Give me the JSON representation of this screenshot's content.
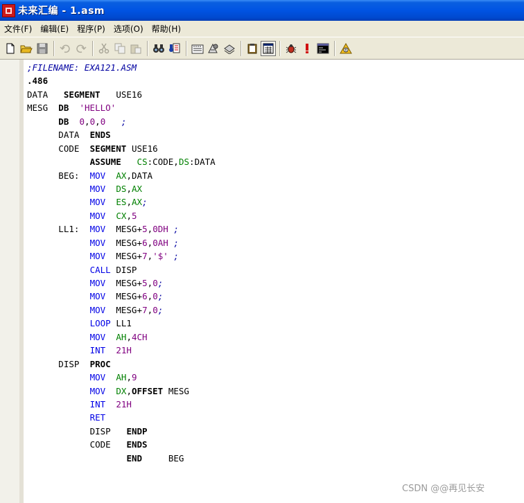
{
  "window": {
    "title": "未来汇编 - 1.asm"
  },
  "menu": [
    "文件(F)",
    "编辑(E)",
    "程序(P)",
    "选项(O)",
    "帮助(H)"
  ],
  "toolbar_groups": [
    [
      "new-file-icon",
      "open-folder-icon",
      "save-disk-icon"
    ],
    [
      "undo-icon",
      "redo-icon"
    ],
    [
      "cut-icon",
      "copy-icon",
      "paste-icon"
    ],
    [
      "find-binoculars-icon",
      "replace-icon"
    ],
    [
      "compile-icon",
      "link-icon",
      "build-icon"
    ],
    [
      "clipboard-icon",
      "register-window-icon"
    ],
    [
      "debug-bug-icon",
      "error-exclamation-icon",
      "console-icon"
    ],
    [
      "help-icon"
    ]
  ],
  "editor": {
    "lines": [
      [
        {
          "t": ";FILENAME: EXA121.ASM",
          "c": "com",
          "col": 0
        }
      ],
      [
        {
          "t": ".486",
          "c": "kw",
          "col": 0
        }
      ],
      [
        {
          "t": "DATA",
          "c": "default",
          "col": 0
        },
        {
          "t": "SEGMENT",
          "c": "kw",
          "col": 7
        },
        {
          "t": "USE16",
          "c": "default",
          "col": 17
        }
      ],
      [
        {
          "t": "MESG",
          "c": "default",
          "col": 0
        },
        {
          "t": "DB",
          "c": "kw",
          "col": 6
        },
        {
          "t": "'HELLO'",
          "c": "str",
          "col": 10
        }
      ],
      [
        {
          "t": "DB",
          "c": "kw",
          "col": 6
        },
        {
          "t": "0",
          "c": "num",
          "col": 10
        },
        {
          "t": ",",
          "c": "punc",
          "col": 11
        },
        {
          "t": "0",
          "c": "num",
          "col": 12
        },
        {
          "t": ",",
          "c": "punc",
          "col": 13
        },
        {
          "t": "0",
          "c": "num",
          "col": 14
        },
        {
          "t": ";",
          "c": "com",
          "col": 18
        }
      ],
      [
        {
          "t": "DATA",
          "c": "default",
          "col": 6
        },
        {
          "t": "ENDS",
          "c": "kw",
          "col": 12
        }
      ],
      [
        {
          "t": "CODE",
          "c": "default",
          "col": 6
        },
        {
          "t": "SEGMENT",
          "c": "kw",
          "col": 12
        },
        {
          "t": "USE16",
          "c": "default",
          "col": 20
        }
      ],
      [
        {
          "t": "ASSUME",
          "c": "kw",
          "col": 12
        },
        {
          "t": "CS",
          "c": "reg",
          "col": 21
        },
        {
          "t": ":CODE,",
          "c": "default",
          "col": 23
        },
        {
          "t": "DS",
          "c": "reg",
          "col": 29
        },
        {
          "t": ":DATA",
          "c": "default",
          "col": 31
        }
      ],
      [
        {
          "t": "BEG:",
          "c": "default",
          "col": 6
        },
        {
          "t": "MOV",
          "c": "ins",
          "col": 12
        },
        {
          "t": "AX",
          "c": "reg",
          "col": 17
        },
        {
          "t": ",DATA",
          "c": "default",
          "col": 19
        }
      ],
      [
        {
          "t": "MOV",
          "c": "ins",
          "col": 12
        },
        {
          "t": "DS",
          "c": "reg",
          "col": 17
        },
        {
          "t": ",",
          "c": "punc",
          "col": 19
        },
        {
          "t": "AX",
          "c": "reg",
          "col": 20
        }
      ],
      [
        {
          "t": "MOV",
          "c": "ins",
          "col": 12
        },
        {
          "t": "ES",
          "c": "reg",
          "col": 17
        },
        {
          "t": ",",
          "c": "punc",
          "col": 19
        },
        {
          "t": "AX",
          "c": "reg",
          "col": 20
        },
        {
          "t": ";",
          "c": "com",
          "col": 22
        }
      ],
      [
        {
          "t": "MOV",
          "c": "ins",
          "col": 12
        },
        {
          "t": "CX",
          "c": "reg",
          "col": 17
        },
        {
          "t": ",",
          "c": "punc",
          "col": 19
        },
        {
          "t": "5",
          "c": "num",
          "col": 20
        }
      ],
      [
        {
          "t": "LL1:",
          "c": "default",
          "col": 6
        },
        {
          "t": "MOV",
          "c": "ins",
          "col": 12
        },
        {
          "t": "MESG+",
          "c": "default",
          "col": 17
        },
        {
          "t": "5",
          "c": "num",
          "col": 22
        },
        {
          "t": ",",
          "c": "punc",
          "col": 23
        },
        {
          "t": "0DH",
          "c": "num",
          "col": 24
        },
        {
          "t": ";",
          "c": "com",
          "col": 28
        }
      ],
      [
        {
          "t": "MOV",
          "c": "ins",
          "col": 12
        },
        {
          "t": "MESG+",
          "c": "default",
          "col": 17
        },
        {
          "t": "6",
          "c": "num",
          "col": 22
        },
        {
          "t": ",",
          "c": "punc",
          "col": 23
        },
        {
          "t": "0AH",
          "c": "num",
          "col": 24
        },
        {
          "t": ";",
          "c": "com",
          "col": 28
        }
      ],
      [
        {
          "t": "MOV",
          "c": "ins",
          "col": 12
        },
        {
          "t": "MESG+",
          "c": "default",
          "col": 17
        },
        {
          "t": "7",
          "c": "num",
          "col": 22
        },
        {
          "t": ",",
          "c": "punc",
          "col": 23
        },
        {
          "t": "'$'",
          "c": "str",
          "col": 24
        },
        {
          "t": ";",
          "c": "com",
          "col": 28
        }
      ],
      [
        {
          "t": "CALL",
          "c": "ins",
          "col": 12
        },
        {
          "t": "DISP",
          "c": "default",
          "col": 17
        }
      ],
      [
        {
          "t": "MOV",
          "c": "ins",
          "col": 12
        },
        {
          "t": "MESG+",
          "c": "default",
          "col": 17
        },
        {
          "t": "5",
          "c": "num",
          "col": 22
        },
        {
          "t": ",",
          "c": "punc",
          "col": 23
        },
        {
          "t": "0",
          "c": "num",
          "col": 24
        },
        {
          "t": ";",
          "c": "com",
          "col": 25
        }
      ],
      [
        {
          "t": "MOV",
          "c": "ins",
          "col": 12
        },
        {
          "t": "MESG+",
          "c": "default",
          "col": 17
        },
        {
          "t": "6",
          "c": "num",
          "col": 22
        },
        {
          "t": ",",
          "c": "punc",
          "col": 23
        },
        {
          "t": "0",
          "c": "num",
          "col": 24
        },
        {
          "t": ";",
          "c": "com",
          "col": 25
        }
      ],
      [
        {
          "t": "MOV",
          "c": "ins",
          "col": 12
        },
        {
          "t": "MESG+",
          "c": "default",
          "col": 17
        },
        {
          "t": "7",
          "c": "num",
          "col": 22
        },
        {
          "t": ",",
          "c": "punc",
          "col": 23
        },
        {
          "t": "0",
          "c": "num",
          "col": 24
        },
        {
          "t": ";",
          "c": "com",
          "col": 25
        }
      ],
      [
        {
          "t": "LOOP",
          "c": "ins",
          "col": 12
        },
        {
          "t": "LL1",
          "c": "default",
          "col": 17
        }
      ],
      [
        {
          "t": "MOV",
          "c": "ins",
          "col": 12
        },
        {
          "t": "AH",
          "c": "reg",
          "col": 17
        },
        {
          "t": ",",
          "c": "punc",
          "col": 19
        },
        {
          "t": "4CH",
          "c": "num",
          "col": 20
        }
      ],
      [
        {
          "t": "INT",
          "c": "ins",
          "col": 12
        },
        {
          "t": "21H",
          "c": "num",
          "col": 17
        }
      ],
      [
        {
          "t": "DISP",
          "c": "default",
          "col": 6
        },
        {
          "t": "PROC",
          "c": "kw",
          "col": 12
        }
      ],
      [
        {
          "t": "MOV",
          "c": "ins",
          "col": 12
        },
        {
          "t": "AH",
          "c": "reg",
          "col": 17
        },
        {
          "t": ",",
          "c": "punc",
          "col": 19
        },
        {
          "t": "9",
          "c": "num",
          "col": 20
        }
      ],
      [
        {
          "t": "MOV",
          "c": "ins",
          "col": 12
        },
        {
          "t": "DX",
          "c": "reg",
          "col": 17
        },
        {
          "t": ",",
          "c": "punc",
          "col": 19
        },
        {
          "t": "OFFSET",
          "c": "kw",
          "col": 20
        },
        {
          "t": "MESG",
          "c": "default",
          "col": 27
        }
      ],
      [
        {
          "t": "INT",
          "c": "ins",
          "col": 12
        },
        {
          "t": "21H",
          "c": "num",
          "col": 17
        }
      ],
      [
        {
          "t": "RET",
          "c": "ins",
          "col": 12
        }
      ],
      [
        {
          "t": "DISP",
          "c": "default",
          "col": 12
        },
        {
          "t": "ENDP",
          "c": "kw",
          "col": 19
        }
      ],
      [
        {
          "t": "CODE",
          "c": "default",
          "col": 12
        },
        {
          "t": "ENDS",
          "c": "kw",
          "col": 19
        }
      ],
      [
        {
          "t": "END",
          "c": "kw",
          "col": 19
        },
        {
          "t": "BEG",
          "c": "default",
          "col": 27
        }
      ]
    ]
  },
  "watermark": "CSDN @@再见长安"
}
